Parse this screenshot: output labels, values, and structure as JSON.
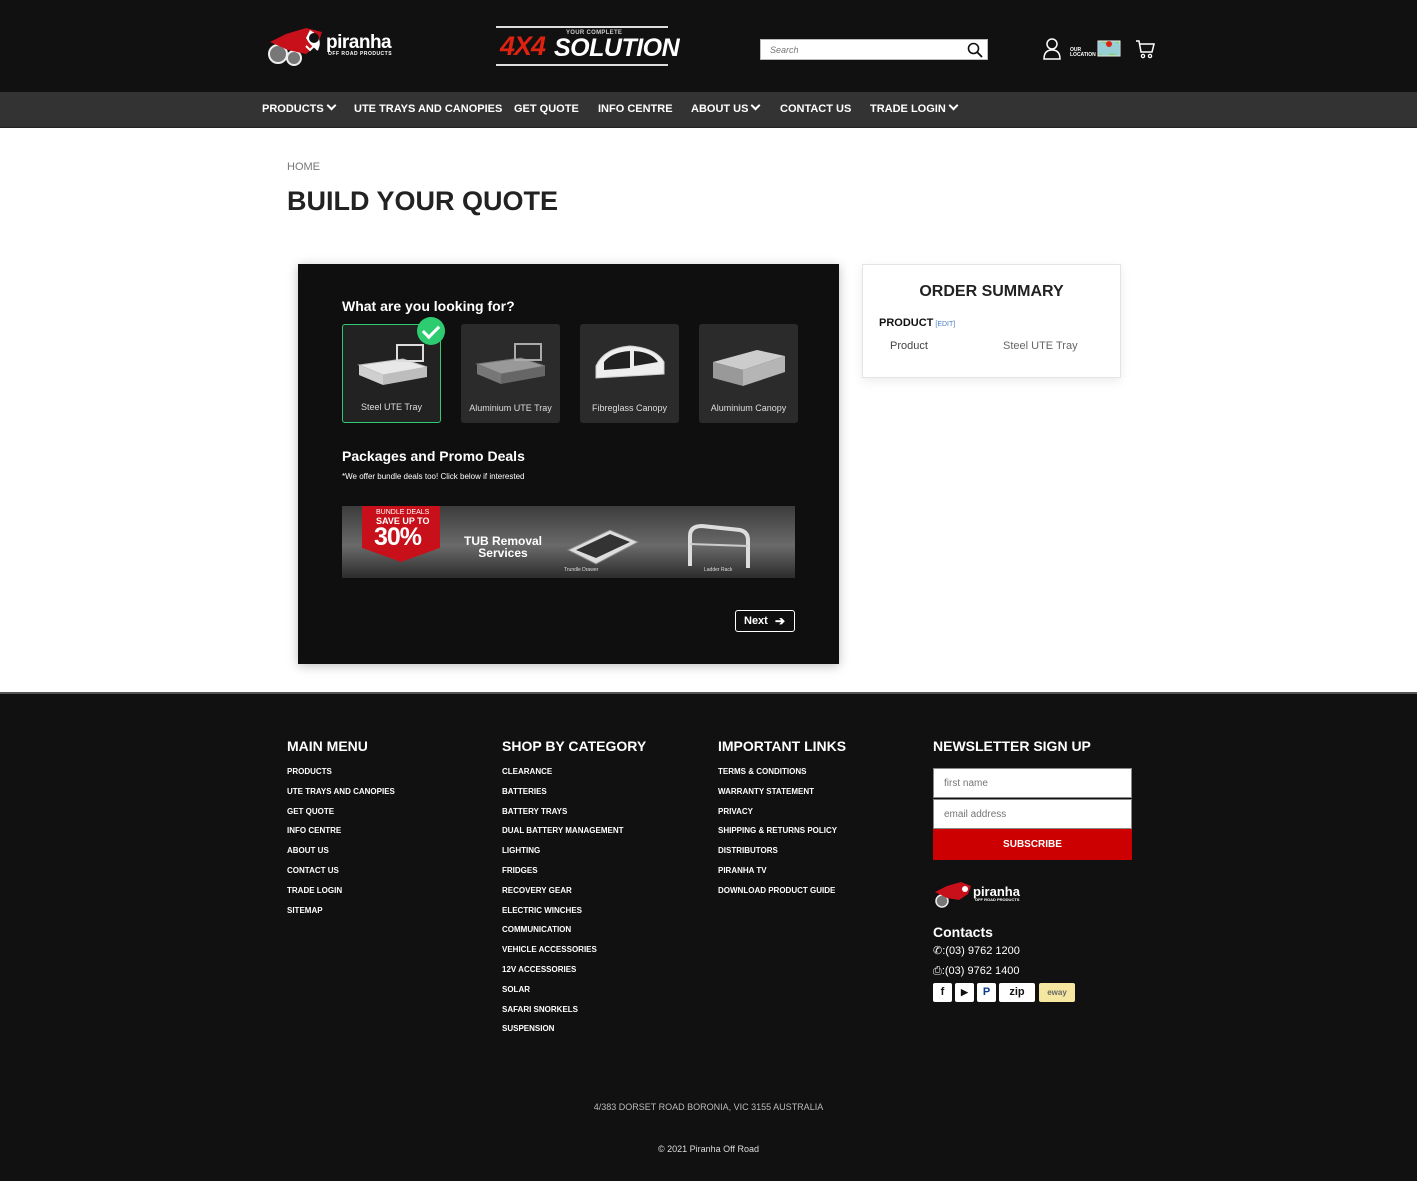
{
  "header": {
    "logo_word": "piranha",
    "logo_sub": "OFF ROAD PRODUCTS",
    "banner_tag": "YOUR COMPLETE",
    "banner_big": "4X4",
    "banner_big2": "SOLUTION",
    "search_placeholder": "Search",
    "location_label": "OUR LOCATION"
  },
  "nav": {
    "items": [
      "PRODUCTS",
      "UTE TRAYS AND CANOPIES",
      "GET QUOTE",
      "INFO CENTRE",
      "ABOUT US",
      "CONTACT US",
      "TRADE LOGIN"
    ]
  },
  "breadcrumb": "HOME",
  "page_title": "BUILD YOUR QUOTE",
  "quote": {
    "question": "What are you looking for?",
    "options": [
      "Steel UTE Tray",
      "Aluminium UTE Tray",
      "Fibreglass Canopy",
      "Aluminium Canopy"
    ],
    "selected": "Steel UTE Tray",
    "packages_title": "Packages and Promo Deals",
    "packages_note": "*We offer bundle deals too! Click below if interested",
    "banner": {
      "badge_line1": "BUNDLE DEALS",
      "badge_line2": "SAVE UP TO",
      "badge_value": "30%",
      "headline": "TUB Removal Services",
      "cap1": "Trundle Drawer",
      "cap2": "Ladder Rack"
    },
    "next_label": "Next"
  },
  "summary": {
    "title": "ORDER SUMMARY",
    "section": "PRODUCT",
    "edit": "[EDIT]",
    "key": "Product",
    "value": "Steel UTE Tray"
  },
  "footer": {
    "main_menu": {
      "title": "MAIN MENU",
      "links": [
        "PRODUCTS",
        "UTE TRAYS AND CANOPIES",
        "GET QUOTE",
        "INFO CENTRE",
        "ABOUT US",
        "CONTACT US",
        "TRADE LOGIN",
        "SITEMAP"
      ]
    },
    "categories": {
      "title": "SHOP BY CATEGORY",
      "links": [
        "CLEARANCE",
        "BATTERIES",
        "BATTERY TRAYS",
        "DUAL BATTERY MANAGEMENT",
        "LIGHTING",
        "FRIDGES",
        "RECOVERY GEAR",
        "ELECTRIC WINCHES",
        "COMMUNICATION",
        "VEHICLE ACCESSORIES",
        "12V ACCESSORIES",
        "SOLAR",
        "SAFARI SNORKELS",
        "SUSPENSION"
      ]
    },
    "important": {
      "title": "IMPORTANT LINKS",
      "links": [
        "TERMS & CONDITIONS",
        "WARRANTY STATEMENT",
        "PRIVACY",
        "SHIPPING & RETURNS POLICY",
        "DISTRIBUTORS",
        "PIRANHA TV",
        "DOWNLOAD PRODUCT GUIDE"
      ]
    },
    "newsletter": {
      "title": "NEWSLETTER SIGN UP",
      "first_name_placeholder": "first name",
      "email_placeholder": "email address",
      "subscribe_label": "SUBSCRIBE"
    },
    "contacts_title": "Contacts",
    "phone": ":(03) 9762 1200",
    "fax": ":(03) 9762 1400",
    "payments": [
      "f",
      "▶",
      "P",
      "zip",
      "eway"
    ],
    "address": "4/383 DORSET ROAD BORONIA, VIC 3155 AUSTRALIA",
    "copyright": "© 2021 Piranha Off Road"
  }
}
